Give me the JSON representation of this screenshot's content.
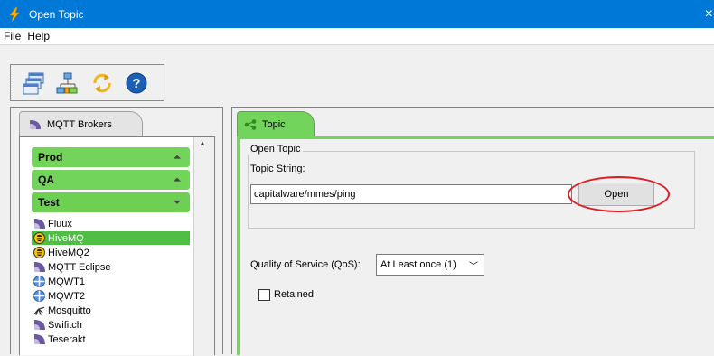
{
  "window": {
    "title": "Open Topic",
    "close_glyph": "×"
  },
  "menu": {
    "items": [
      "File",
      "Help"
    ]
  },
  "toolbar": {
    "buttons": [
      "window-stack-icon",
      "network-connect-icon",
      "refresh-icon",
      "help-icon"
    ]
  },
  "left_panel": {
    "tab_label": "MQTT Brokers",
    "groups": [
      {
        "label": "Prod",
        "state": "collapsed"
      },
      {
        "label": "QA",
        "state": "collapsed"
      },
      {
        "label": "Test",
        "state": "expanded"
      }
    ],
    "brokers": [
      "Fluux",
      "HiveMQ",
      "HiveMQ2",
      "MQTT Eclipse",
      "MQWT1",
      "MQWT2",
      "Mosquitto",
      "Swifitch",
      "Teserakt"
    ],
    "selected_broker": "HiveMQ"
  },
  "right_panel": {
    "tab_label": "Topic",
    "group_title": "Open Topic",
    "topic_label": "Topic String:",
    "topic_value": "capitalware/mmes/ping",
    "open_button": "Open",
    "qos_label": "Quality of Service (QoS):",
    "qos_value": "At Least once (1)",
    "retained_label": "Retained",
    "retained_checked": false
  },
  "colors": {
    "titlebar": "#0078d7",
    "accent_green": "#72d45a",
    "highlight_red": "#e01b24"
  }
}
